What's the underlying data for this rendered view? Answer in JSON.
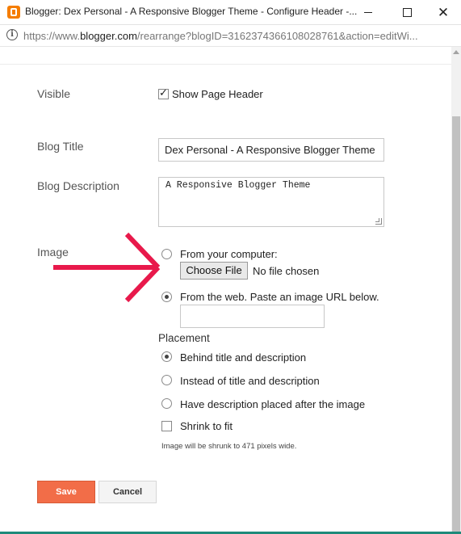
{
  "window": {
    "title": "Blogger: Dex Personal - A Responsive Blogger Theme - Configure Header -...",
    "url_prefix": "https://www.",
    "url_host": "blogger.com",
    "url_rest": "/rearrange?blogID=3162374366108028761&action=editWi..."
  },
  "form": {
    "visible": {
      "label": "Visible",
      "checkbox_label": "Show Page Header",
      "checked": true
    },
    "blog_title": {
      "label": "Blog Title",
      "value": "Dex Personal - A Responsive Blogger Theme"
    },
    "blog_description": {
      "label": "Blog Description",
      "value": "A Responsive Blogger Theme"
    },
    "image": {
      "label": "Image",
      "from_computer_label": "From your computer:",
      "choose_file_label": "Choose File",
      "no_file_label": "No file chosen",
      "from_web_label": "From the web. Paste an image URL below.",
      "url_value": "",
      "selected_source": "web"
    },
    "placement": {
      "label": "Placement",
      "options": [
        {
          "label": "Behind title and description",
          "selected": true
        },
        {
          "label": "Instead of title and description",
          "selected": false
        },
        {
          "label": "Have description placed after the image",
          "selected": false
        }
      ],
      "shrink_label": "Shrink to fit",
      "shrink_checked": false,
      "note": "Image will be shrunk to 471 pixels wide."
    }
  },
  "actions": {
    "save_label": "Save",
    "cancel_label": "Cancel"
  },
  "colors": {
    "save_button": "#f26d48",
    "annotation_arrow": "#e8194b",
    "blogger_icon": "#f57d00",
    "taskbar_strip": "#1e8a7a"
  }
}
